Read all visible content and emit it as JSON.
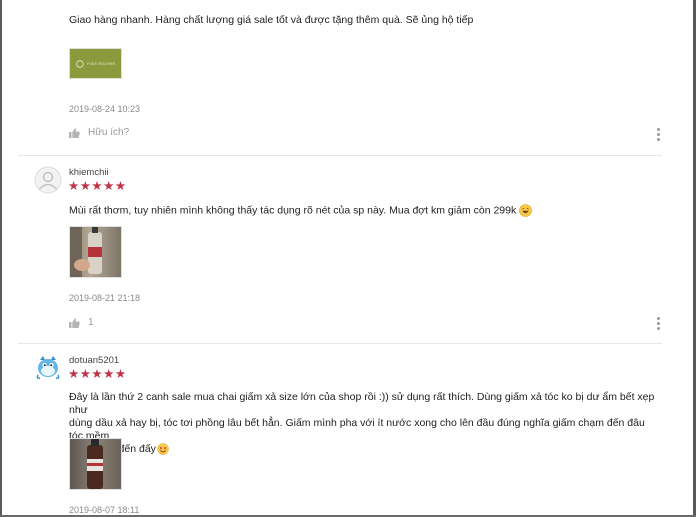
{
  "reviews": [
    {
      "comment": "Giao hàng nhanh. Hàng chất lượng giá sale tốt và được tặng thêm quà. Sẽ ủng hộ tiếp",
      "logo_text": "YVES ROCHER",
      "date": "2019-08-24 10:23",
      "like_label": "Hữu ích?"
    },
    {
      "username": "khiemchii",
      "stars": "★★★★★",
      "comment": "Mùi rất thơm, tuy nhiên mình không thấy tác dụng rõ nét của sp này. Mua đợt km giảm còn 299k",
      "date": "2019-08-21 21:18",
      "like_count": "1"
    },
    {
      "username": "dotuan5201",
      "stars": "★★★★★",
      "comment_line1": "Đây là lần thứ 2 canh sale mua chai giấm xả size lớn của shop rồi :)) sử dụng rất thích. Dùng giấm xả tóc ko bị dư ẩm bết xẹp như",
      "comment_line2": "dùng dầu xả hay bị, tóc tơi phồng lâu bết hẳn. Giấm mình pha với ít nước xong cho lên đầu đúng nghĩa giấm chạm đến đâu tóc mềm",
      "comment_line3": "như nước đến đấy",
      "date": "2019-08-07 18:11"
    }
  ],
  "colors": {
    "star": "#c0334a",
    "date": "#8a8a8a",
    "divider": "#e6e6e6"
  },
  "icons": [
    "thumb-up-icon",
    "more-vertical-icon",
    "default-avatar-icon",
    "cartoon-avatar-icon",
    "grin-emoji-icon",
    "heart-eyes-emoji-icon"
  ]
}
